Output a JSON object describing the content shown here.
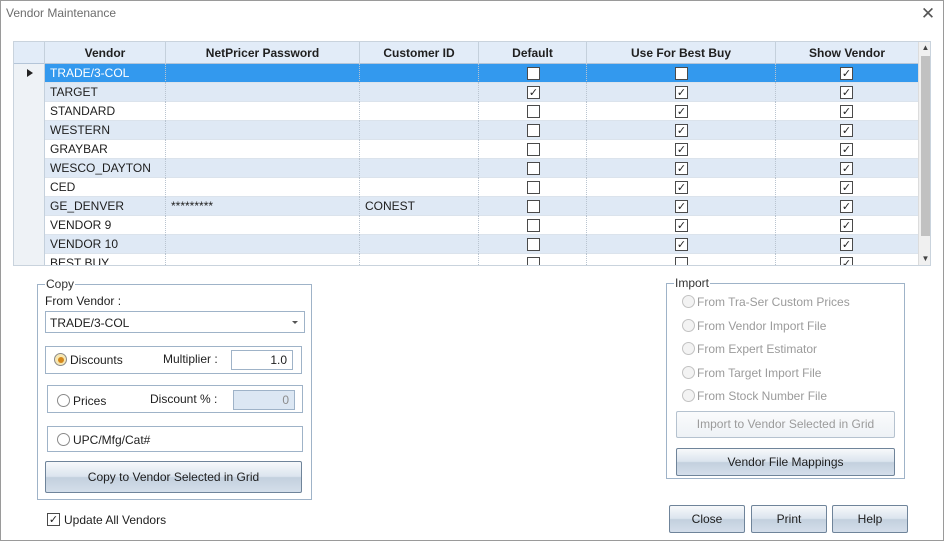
{
  "window": {
    "title": "Vendor Maintenance",
    "close_glyph": "✕"
  },
  "grid": {
    "columns": [
      "Vendor",
      "NetPricer Password",
      "Customer ID",
      "Default",
      "Use For Best Buy",
      "Show Vendor"
    ],
    "rows": [
      {
        "vendor": "TRADE/3-COL",
        "password": "",
        "customer_id": "",
        "default": false,
        "best_buy": false,
        "show": true,
        "selected": true
      },
      {
        "vendor": "TARGET",
        "password": "",
        "customer_id": "",
        "default": true,
        "best_buy": true,
        "show": true
      },
      {
        "vendor": "STANDARD",
        "password": "",
        "customer_id": "",
        "default": false,
        "best_buy": true,
        "show": true
      },
      {
        "vendor": "WESTERN",
        "password": "",
        "customer_id": "",
        "default": false,
        "best_buy": true,
        "show": true
      },
      {
        "vendor": "GRAYBAR",
        "password": "",
        "customer_id": "",
        "default": false,
        "best_buy": true,
        "show": true
      },
      {
        "vendor": "WESCO_DAYTON",
        "password": "",
        "customer_id": "",
        "default": false,
        "best_buy": true,
        "show": true
      },
      {
        "vendor": "CED",
        "password": "",
        "customer_id": "",
        "default": false,
        "best_buy": true,
        "show": true
      },
      {
        "vendor": "GE_DENVER",
        "password": "*********",
        "customer_id": "CONEST",
        "default": false,
        "best_buy": true,
        "show": true
      },
      {
        "vendor": "VENDOR 9",
        "password": "",
        "customer_id": "",
        "default": false,
        "best_buy": true,
        "show": true
      },
      {
        "vendor": "VENDOR 10",
        "password": "",
        "customer_id": "",
        "default": false,
        "best_buy": true,
        "show": true
      },
      {
        "vendor": "BEST BUY",
        "password": "",
        "customer_id": "",
        "default": false,
        "best_buy": false,
        "show": true
      }
    ]
  },
  "copy": {
    "legend": "Copy",
    "from_vendor_label": "From Vendor :",
    "from_vendor_value": "TRADE/3-COL",
    "discounts_label": "Discounts",
    "multiplier_label": "Multiplier :",
    "multiplier_value": "1.0",
    "prices_label": "Prices",
    "discount_pct_label": "Discount % :",
    "discount_pct_value": "0",
    "upc_label": "UPC/Mfg/Cat#",
    "copy_button": "Copy to Vendor Selected in Grid",
    "selected_option": "discounts"
  },
  "import": {
    "legend": "Import",
    "options": [
      "From Tra-Ser Custom Prices",
      "From Vendor Import File",
      "From Expert Estimator",
      "From Target Import File",
      "From Stock Number File"
    ],
    "import_button": "Import to Vendor Selected in Grid",
    "mappings_button": "Vendor File Mappings"
  },
  "update_all": {
    "label": "Update All Vendors",
    "checked": true
  },
  "buttons": {
    "close": "Close",
    "print": "Print",
    "help": "Help"
  },
  "icons": {
    "selected_row": "row-pointer-icon",
    "dropdown": "chevron-down-icon",
    "check": "checkmark-icon"
  }
}
